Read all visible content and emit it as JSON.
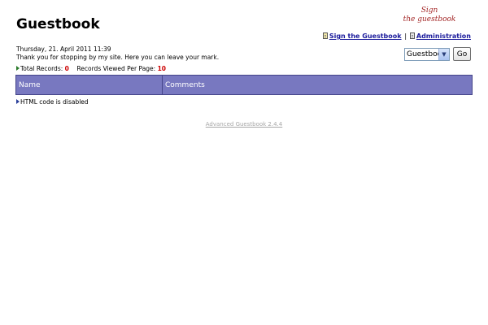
{
  "page": {
    "title": "Guestbook"
  },
  "logo": {
    "line1": "Sign",
    "line2": "the guestbook"
  },
  "links": {
    "sign": "Sign the Guestbook",
    "separator": "|",
    "admin": "Administration"
  },
  "selector": {
    "value": "Guestbook",
    "go_label": "Go"
  },
  "info": {
    "date": "Thursday, 21. April 2011 11:39",
    "intro": "Thank you for stopping by my site. Here you can leave your mark.",
    "total_label": "Total Records:",
    "total_value": "0",
    "per_page_label": "Records Viewed Per Page:",
    "per_page_value": "10"
  },
  "table": {
    "columns": [
      "Name",
      "Comments"
    ]
  },
  "notes": {
    "html": "HTML code is disabled"
  },
  "footer": {
    "credit": "Advanced Guestbook 2.4.4"
  },
  "colors": {
    "header_bg": "#7878c0",
    "link": "#1b1b9c",
    "record_num": "#cc0000",
    "logo": "#a32626"
  },
  "icons": {
    "sign": "document-icon",
    "admin": "document-icon",
    "bullet": "triangle-right-icon",
    "dropdown": "chevron-down-icon"
  }
}
